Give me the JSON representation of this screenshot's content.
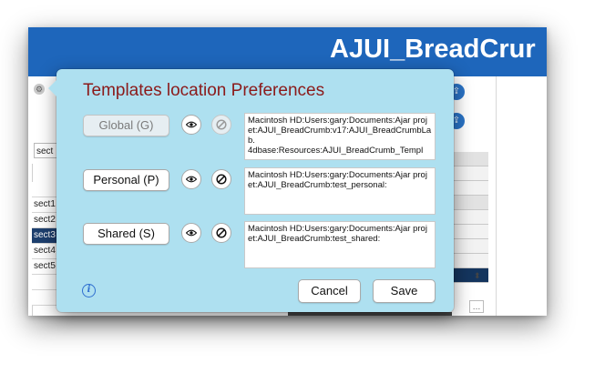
{
  "app": {
    "banner_title": "AJUI_BreadCrur",
    "side_field_value": "sect",
    "list_items": [
      "",
      "sect1",
      "sect2",
      "sect3",
      "sect4",
      "sect5"
    ],
    "selected_index": 3,
    "colors": {
      "banner": "#1e66bb",
      "dialog_bg": "#aee0f0",
      "title": "#8b1a1a",
      "selection": "#1d3f6e"
    }
  },
  "dialog": {
    "title": "Templates location Preferences",
    "rows": [
      {
        "button_label": "Global (G)",
        "path": "Macintosh HD:Users:gary:Documents:Ajar projet:AJUI_BreadCrumb:v17:AJUI_BreadCrumbLab.\n4dbase:Resources:AJUI_BreadCrumb_Templ",
        "enabled": false
      },
      {
        "button_label": "Personal (P)",
        "path": "Macintosh HD:Users:gary:Documents:Ajar projet:AJUI_BreadCrumb:test_personal:",
        "enabled": true
      },
      {
        "button_label": "Shared (S)",
        "path": "Macintosh HD:Users:gary:Documents:Ajar projet:AJUI_BreadCrumb:test_shared:",
        "enabled": true
      }
    ],
    "cancel_label": "Cancel",
    "save_label": "Save",
    "icons": {
      "show": "eye-icon",
      "clear": "prohibit-icon",
      "info": "info-icon"
    }
  }
}
